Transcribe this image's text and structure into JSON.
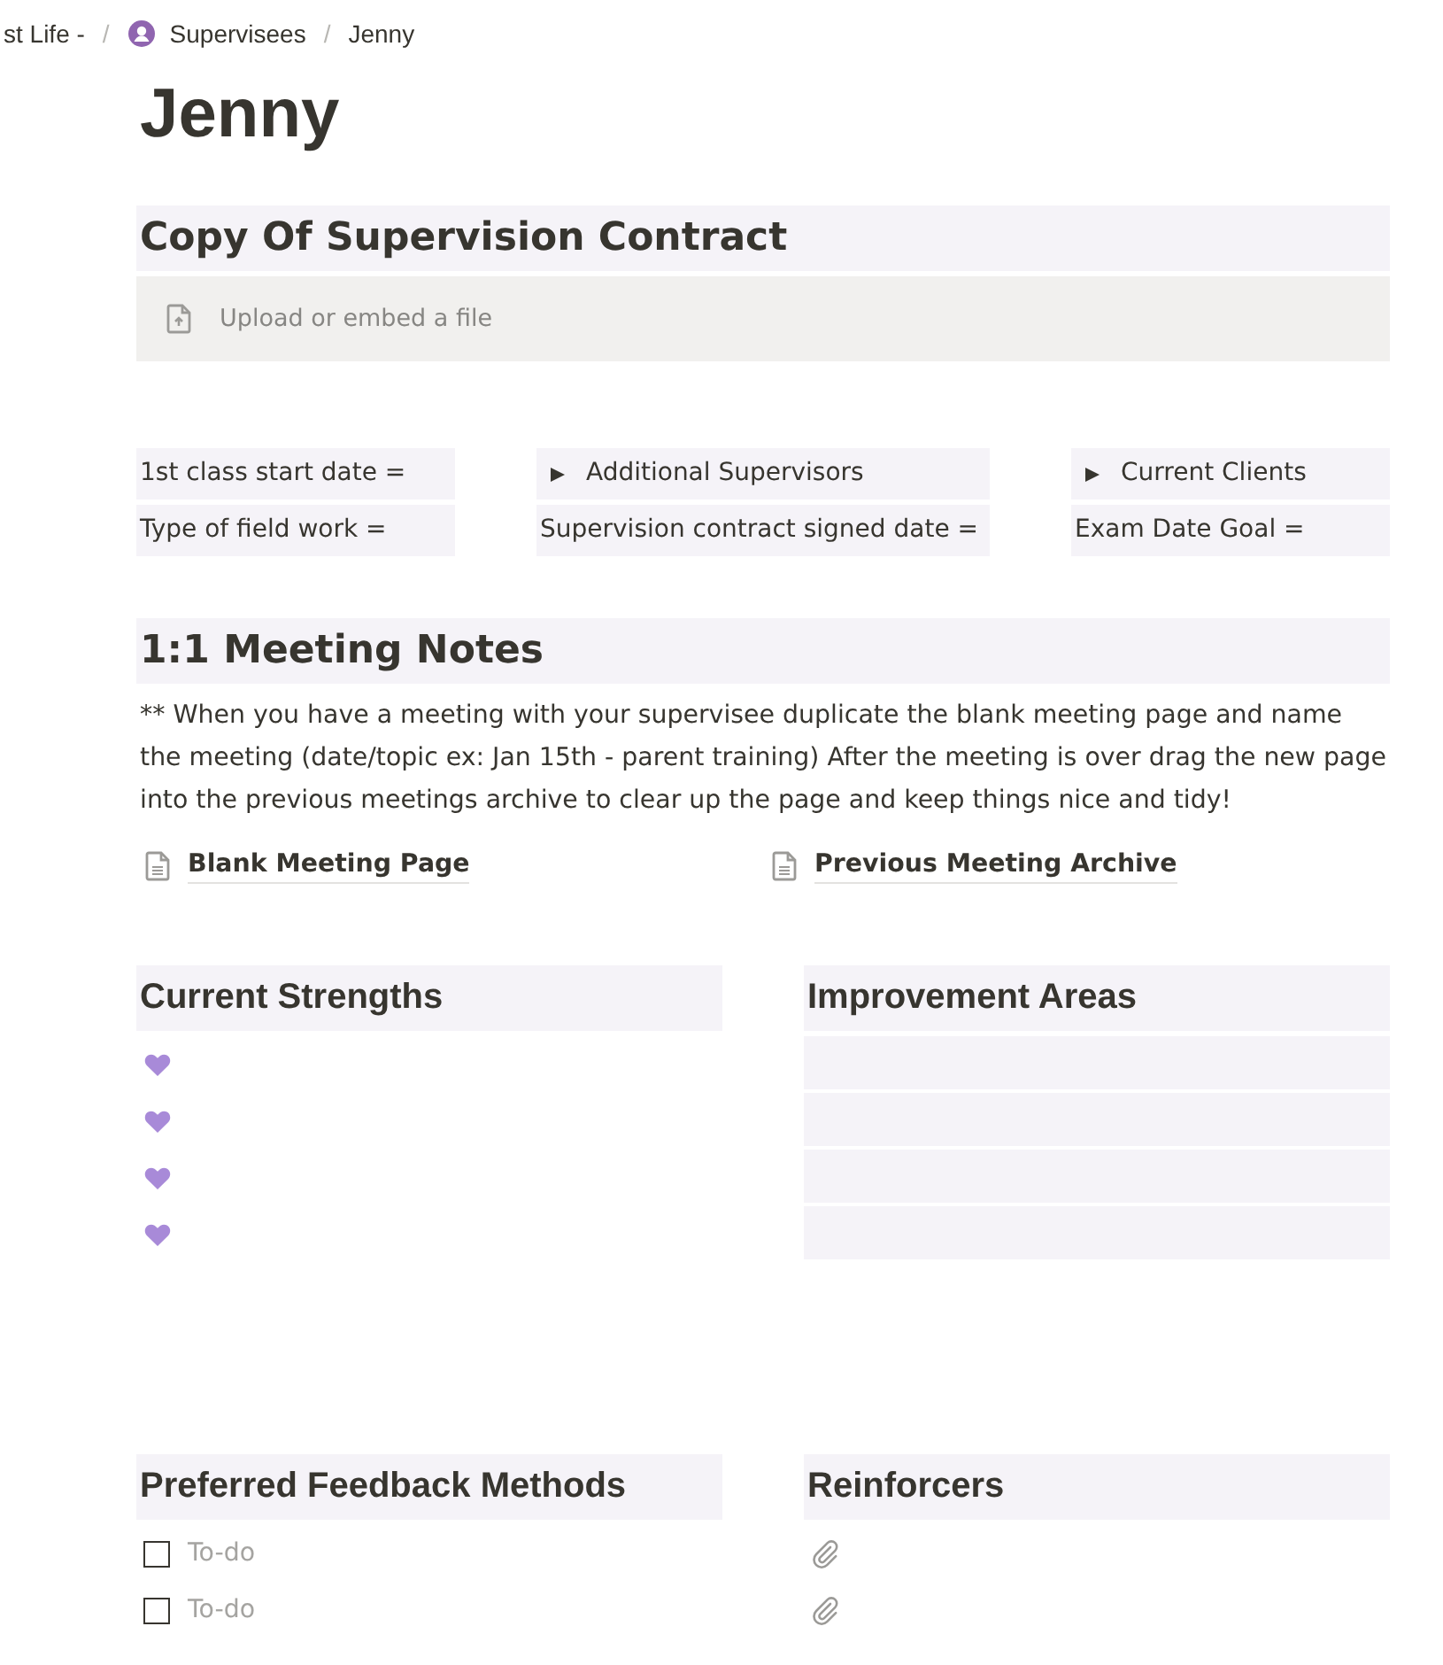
{
  "breadcrumb": [
    {
      "label": "st Life -",
      "kind": "plain"
    },
    {
      "separator": "/",
      "label": "Supervisees",
      "kind": "with-icon"
    },
    {
      "separator": "/",
      "label": "Jenny",
      "kind": "plain"
    }
  ],
  "title": "Jenny",
  "contract": {
    "heading": "Copy Of Supervision Contract",
    "upload": "Upload or embed a file"
  },
  "properties": [
    [
      {
        "kind": "text",
        "label": "1st class start date ="
      },
      {
        "kind": "text",
        "label": "Type of field work ="
      }
    ],
    [
      {
        "kind": "toggle",
        "label": "Additional Supervisors",
        "expanded": false
      },
      {
        "kind": "text",
        "label": "Supervision contract signed date ="
      }
    ],
    [
      {
        "kind": "toggle",
        "label": "Current Clients",
        "expanded": false
      },
      {
        "kind": "text",
        "label": "Exam Date Goal ="
      }
    ]
  ],
  "meeting_notes": {
    "heading": "1:1 Meeting Notes",
    "text": "** When you have a meeting with your supervisee duplicate the blank meeting page and name the meeting (date/topic ex: Jan 15th - parent training) After the meeting is over drag the new page into the previous meetings archive to clear up the page and keep things nice and tidy!",
    "links": [
      "Blank Meeting Page",
      "Previous Meeting Archive"
    ]
  },
  "sections": [
    {
      "heading": "Current Strengths",
      "items": [
        {
          "kind": "heart"
        },
        {
          "kind": "heart"
        },
        {
          "kind": "heart"
        },
        {
          "kind": "heart"
        }
      ]
    },
    {
      "heading": "Improvement Areas",
      "items": [
        {
          "kind": "blank-row"
        },
        {
          "kind": "blank-row"
        },
        {
          "kind": "blank-row"
        },
        {
          "kind": "blank-row"
        }
      ]
    },
    {
      "heading": "Preferred Feedback Methods",
      "items": [
        {
          "kind": "todo",
          "placeholder": "To-do",
          "checked": false
        },
        {
          "kind": "todo",
          "placeholder": "To-do",
          "checked": false
        }
      ]
    },
    {
      "heading": "Reinforcers",
      "items": [
        {
          "kind": "attachment"
        },
        {
          "kind": "attachment"
        }
      ]
    }
  ]
}
